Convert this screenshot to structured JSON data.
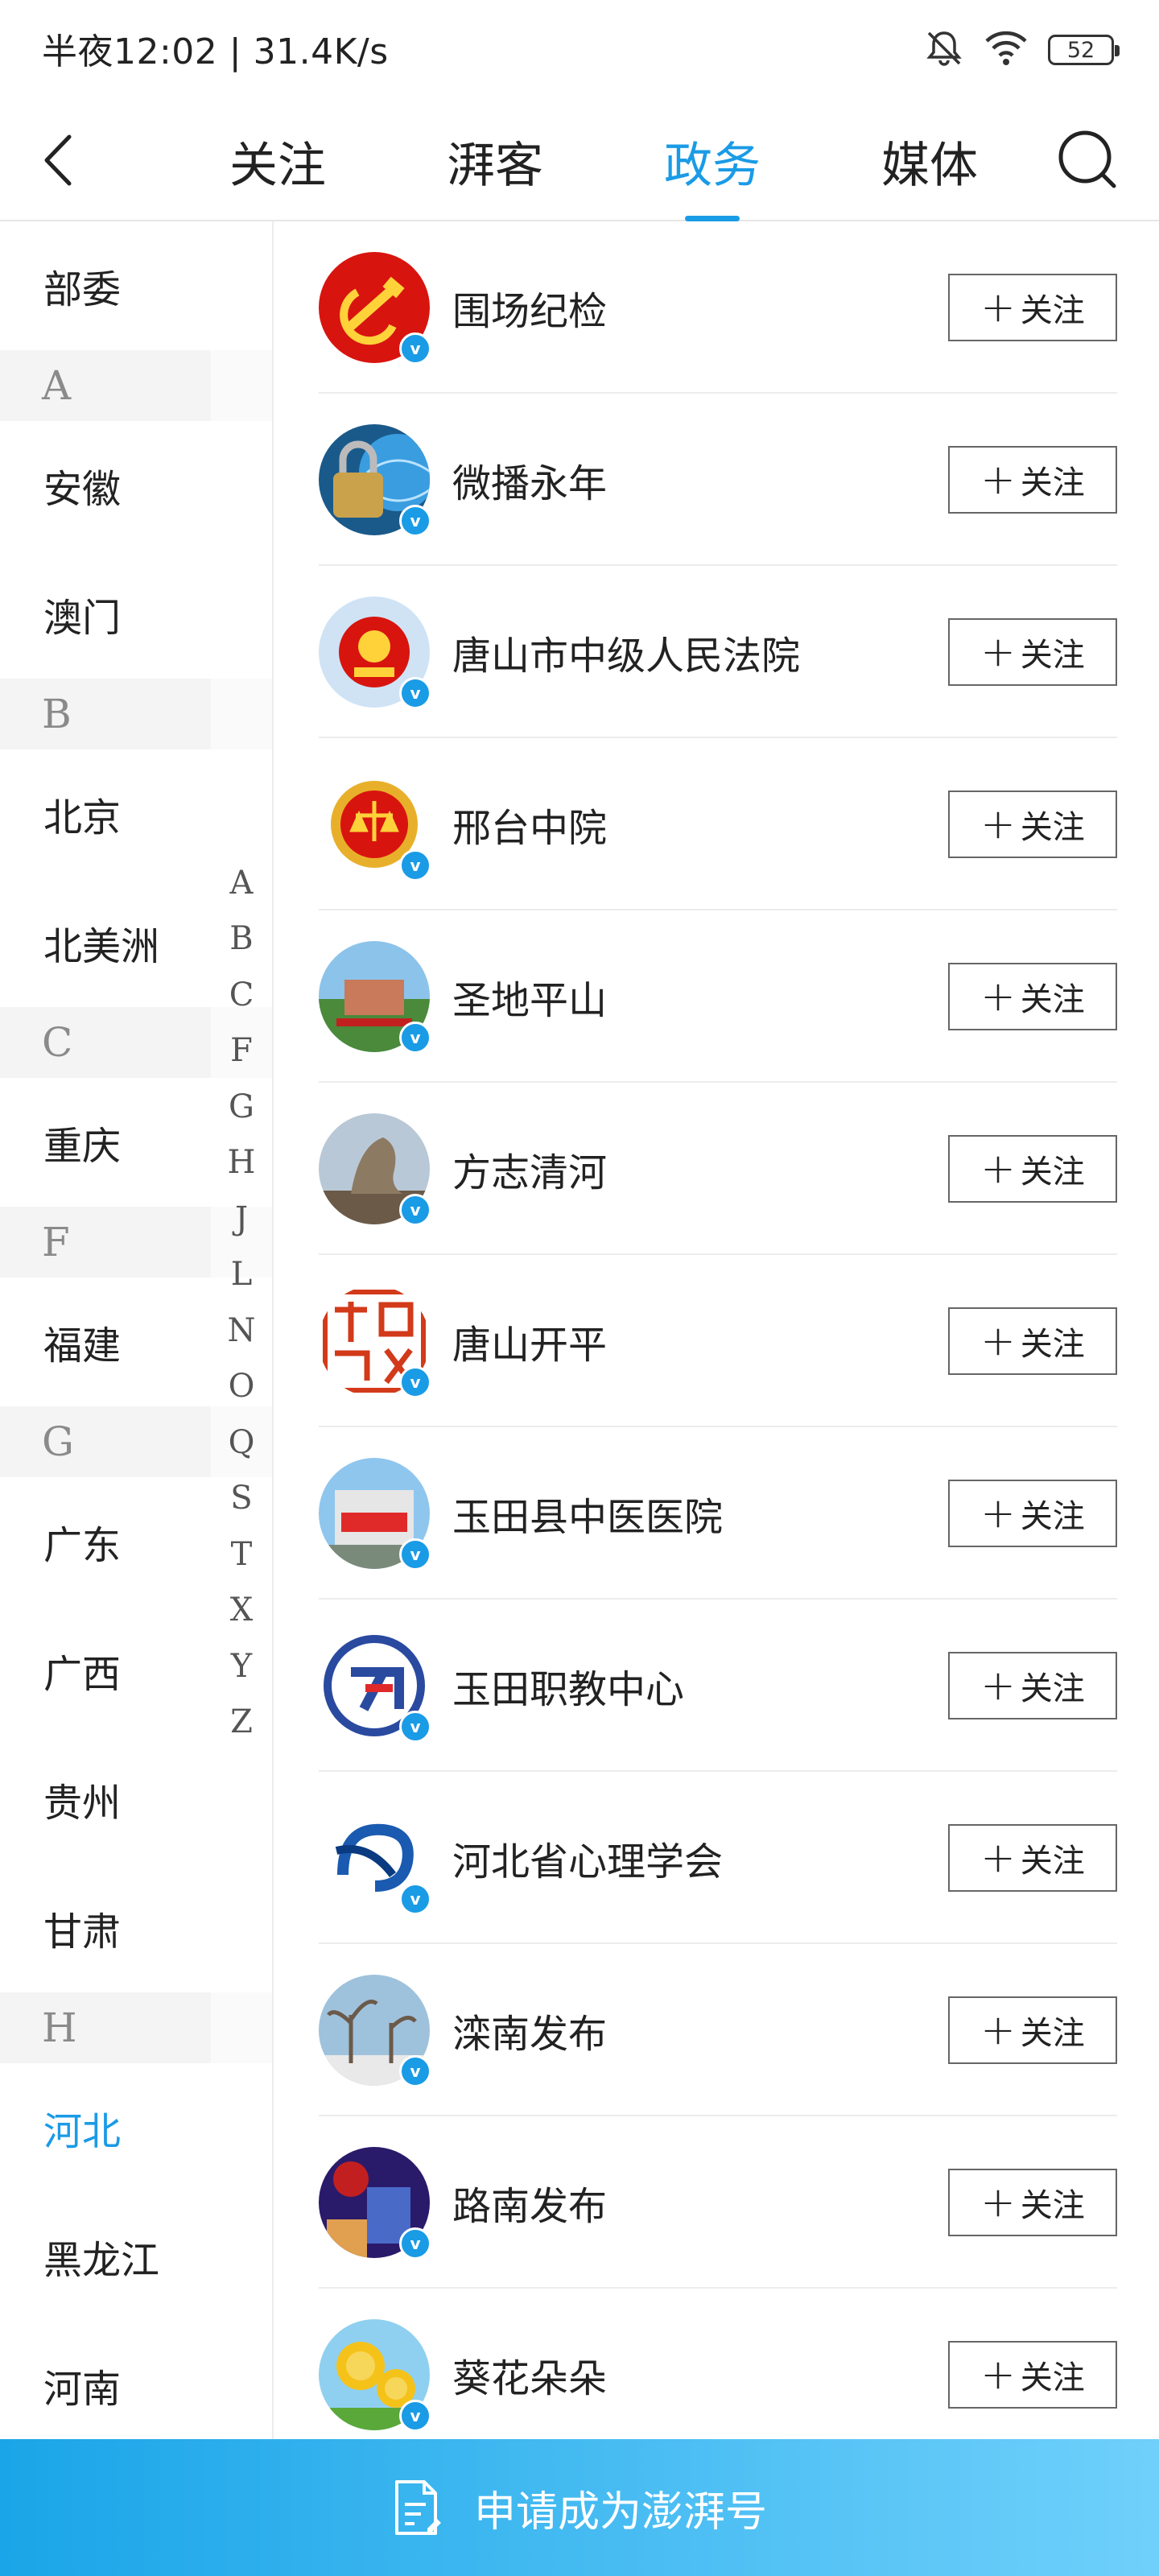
{
  "status": {
    "time_speed": "半夜12:02 | 31.4K/s",
    "battery": "52"
  },
  "tabs": [
    {
      "label": "关注"
    },
    {
      "label": "湃客"
    },
    {
      "label": "政务"
    },
    {
      "label": "媒体"
    }
  ],
  "active_tab": "政务",
  "sidebar": {
    "first": "部委",
    "groups": [
      {
        "header": "A",
        "items": [
          "安徽",
          "澳门"
        ]
      },
      {
        "header": "B",
        "items": [
          "北京",
          "北美洲"
        ]
      },
      {
        "header": "C",
        "items": [
          "重庆"
        ]
      },
      {
        "header": "F",
        "items": [
          "福建"
        ]
      },
      {
        "header": "G",
        "items": [
          "广东",
          "广西",
          "贵州",
          "甘肃"
        ]
      },
      {
        "header": "H",
        "items": [
          "河北",
          "黑龙江",
          "河南"
        ]
      }
    ],
    "active_item": "河北"
  },
  "alpha_index": [
    "A",
    "B",
    "C",
    "F",
    "G",
    "H",
    "J",
    "L",
    "N",
    "O",
    "Q",
    "S",
    "T",
    "X",
    "Y",
    "Z"
  ],
  "list": [
    {
      "name": "围场纪检",
      "follow": "关注"
    },
    {
      "name": "微播永年",
      "follow": "关注"
    },
    {
      "name": "唐山市中级人民法院",
      "follow": "关注"
    },
    {
      "name": "邢台中院",
      "follow": "关注"
    },
    {
      "name": "圣地平山",
      "follow": "关注"
    },
    {
      "name": "方志清河",
      "follow": "关注"
    },
    {
      "name": "唐山开平",
      "follow": "关注"
    },
    {
      "name": "玉田县中医医院",
      "follow": "关注"
    },
    {
      "name": "玉田职教中心",
      "follow": "关注"
    },
    {
      "name": "河北省心理学会",
      "follow": "关注"
    },
    {
      "name": "滦南发布",
      "follow": "关注"
    },
    {
      "name": "路南发布",
      "follow": "关注"
    },
    {
      "name": "葵花朵朵",
      "follow": "关注"
    }
  ],
  "verified_badge": "v",
  "bottom_action": "申请成为澎湃号",
  "colors": {
    "accent": "#1a9be6",
    "bottom_gradient_start": "#1aa5e8",
    "bottom_gradient_end": "#6fd0fb"
  }
}
